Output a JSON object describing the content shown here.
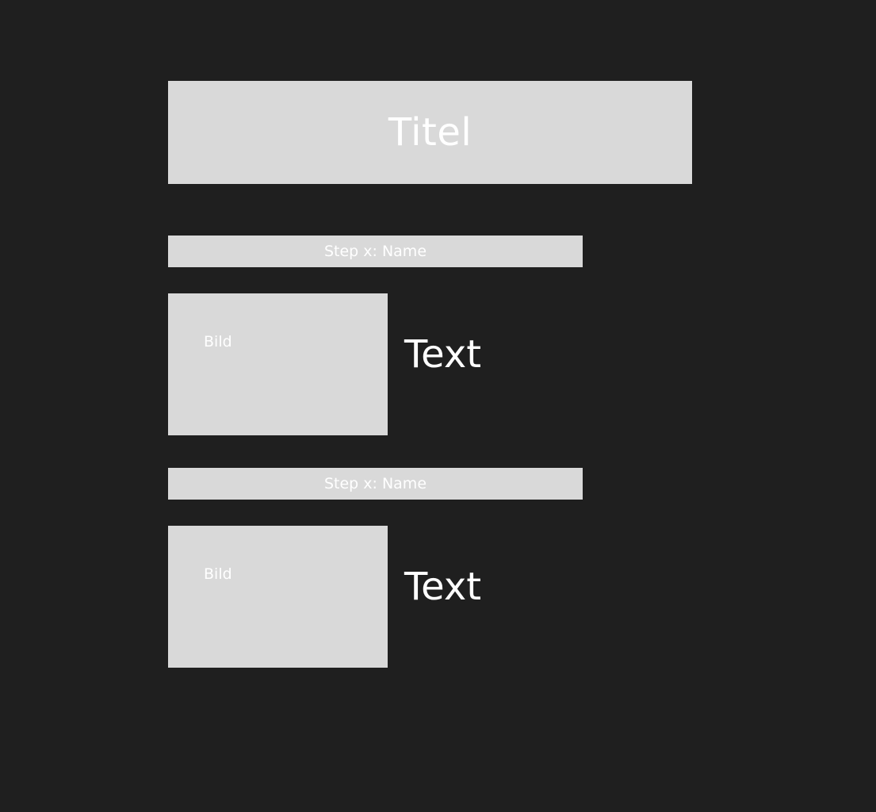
{
  "title": "Titel",
  "steps": [
    {
      "name": "Step x: Name",
      "image_label": "Bild",
      "text": "Text"
    },
    {
      "name": "Step x: Name",
      "image_label": "Bild",
      "text": "Text"
    }
  ],
  "colors": {
    "background": "#1f1f1f",
    "placeholder": "#d9d9d9",
    "text": "#ffffff"
  }
}
